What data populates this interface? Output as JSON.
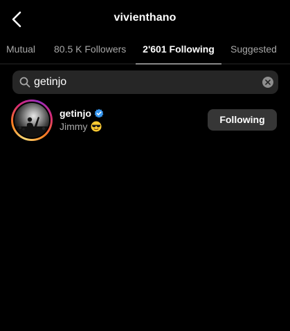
{
  "header": {
    "title": "vivienthano",
    "back_icon": "chevron-left-icon"
  },
  "tabs": [
    {
      "label": "Mutual",
      "active": false
    },
    {
      "label": "80.5 K Followers",
      "active": false
    },
    {
      "label": "2'601 Following",
      "active": true
    },
    {
      "label": "Suggested",
      "active": false
    }
  ],
  "search": {
    "value": "getinjo",
    "icon": "search-icon",
    "clear_icon": "clear-icon"
  },
  "results": [
    {
      "username": "getinjo",
      "verified": true,
      "full_name": "Jimmy",
      "emoji": "😎",
      "button_label": "Following"
    }
  ],
  "colors": {
    "background": "#000000",
    "text_primary": "#ffffff",
    "text_secondary": "#a8a8a8",
    "search_bg": "#262626",
    "button_bg": "#363636",
    "verified_blue": "#3797f0"
  }
}
